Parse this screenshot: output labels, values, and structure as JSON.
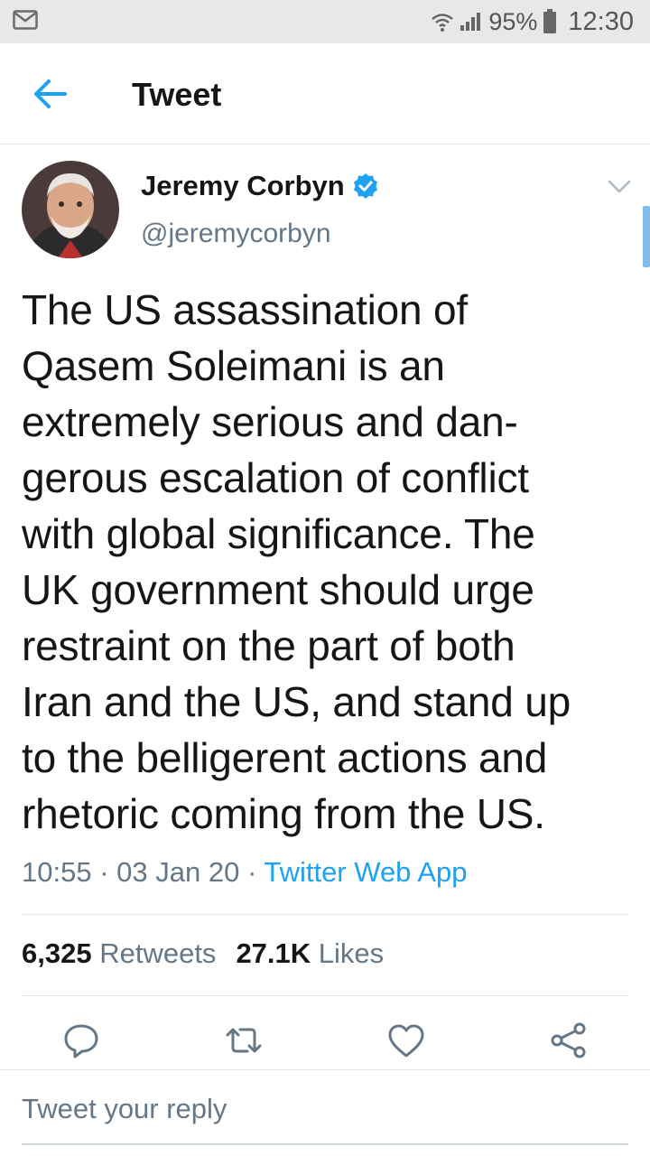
{
  "status_bar": {
    "battery_percent": "95%",
    "time": "12:30"
  },
  "header": {
    "title": "Tweet"
  },
  "tweet": {
    "author_name": "Jeremy Corbyn",
    "author_handle": "@jeremycorbyn",
    "verified": true,
    "text_lines": [
      "The US assassination of",
      "Qasem Soleimani is an",
      "extremely serious and dan-",
      "gerous escalation of conflict",
      "with global significance. The",
      "UK government should urge",
      "restraint on the part of both",
      "Iran and the US, and stand up",
      "to the belligerent actions and",
      "rhetoric coming from the US."
    ],
    "time": "10:55",
    "date": "03 Jan 20",
    "separator": "·",
    "source": "Twitter Web App",
    "retweets_count": "6,325",
    "retweets_label": "Retweets",
    "likes_count": "27.1K",
    "likes_label": "Likes"
  },
  "icons": {
    "status": [
      "mail-icon",
      "wifi-icon",
      "signal-icon",
      "battery-icon"
    ],
    "actions": [
      "reply-icon",
      "retweet-icon",
      "like-icon",
      "share-icon"
    ]
  },
  "reply": {
    "placeholder": "Tweet your reply"
  },
  "colors": {
    "accent": "#1da1f2",
    "secondary_text": "#657786",
    "status_bar_bg": "#e8e8e8"
  }
}
